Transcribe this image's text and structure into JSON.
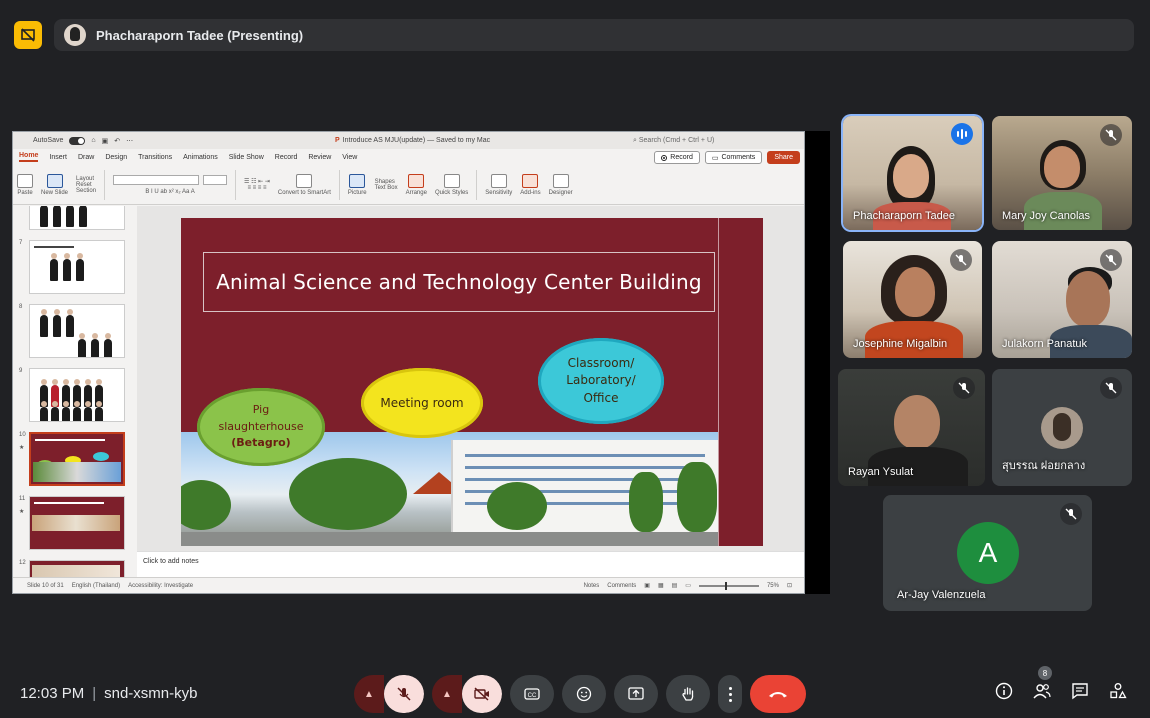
{
  "meeting": {
    "presenter_label": "Phacharaporn Tadee (Presenting)",
    "time": "12:03 PM",
    "code": "snd-xsmn-kyb",
    "participant_count": "8"
  },
  "ppt": {
    "autosave": "AutoSave",
    "doc_title": "Introduce AS MJU(update) — Saved to my Mac",
    "search": "Search (Cmd + Ctrl + U)",
    "menus": [
      "Home",
      "Insert",
      "Draw",
      "Design",
      "Transitions",
      "Animations",
      "Slide Show",
      "Record",
      "Review",
      "View"
    ],
    "record_btn": "Record",
    "comments_btn": "Comments",
    "share_btn": "Share",
    "ribbon": {
      "paste": "Paste",
      "new_slide": "New Slide",
      "layout": "Layout",
      "reset": "Reset",
      "section": "Section",
      "convert": "Convert to SmartArt",
      "picture": "Picture",
      "shapes": "Shapes",
      "text_box": "Text Box",
      "arrange": "Arrange",
      "quick_styles": "Quick Styles",
      "sensitivity": "Sensitivity",
      "add_ins": "Add-ins",
      "designer": "Designer"
    },
    "thumbnails": [
      {
        "num": "7",
        "star": ""
      },
      {
        "num": "8",
        "star": ""
      },
      {
        "num": "9",
        "star": ""
      },
      {
        "num": "10",
        "star": "★"
      },
      {
        "num": "11",
        "star": "★"
      },
      {
        "num": "12",
        "star": ""
      }
    ],
    "slide": {
      "title": "Animal Science and Technology Center Building",
      "bubble_green_l1": "Pig",
      "bubble_green_l2": "slaughterhouse",
      "bubble_green_l3": "(Betagro)",
      "bubble_yellow": "Meeting room",
      "bubble_cyan_l1": "Classroom/",
      "bubble_cyan_l2": "Laboratory/",
      "bubble_cyan_l3": "Office"
    },
    "notes_placeholder": "Click to add notes",
    "status": {
      "slide_of": "Slide 10 of 31",
      "language": "English (Thailand)",
      "accessibility": "Accessibility: Investigate",
      "notes": "Notes",
      "comments": "Comments",
      "zoom": "75%"
    }
  },
  "participants": [
    {
      "name": "Phacharaporn Tadee",
      "state": "speaking"
    },
    {
      "name": "Mary Joy Canolas",
      "state": "muted"
    },
    {
      "name": "Josephine Migalbin",
      "state": "muted"
    },
    {
      "name": "Julakorn Panatuk",
      "state": "muted"
    },
    {
      "name": "Rayan Ysulat",
      "state": "muted"
    },
    {
      "name": "สุบรรณ ฝอยกลาง",
      "state": "muted"
    },
    {
      "name": "Ar-Jay Valenzuela",
      "state": "muted",
      "initial": "A"
    }
  ],
  "colors": {
    "accent": "#fbbc04",
    "end_call": "#ea4335",
    "slide_bg": "#7d1f2b",
    "avatar_green": "#1e8e3e"
  },
  "icons": [
    "present-icon",
    "mic-off-icon",
    "camera-off-icon",
    "captions-icon",
    "emoji-icon",
    "present-screen-icon",
    "raise-hand-icon",
    "more-icon",
    "end-call-icon",
    "info-icon",
    "people-icon",
    "chat-icon",
    "activities-icon"
  ]
}
